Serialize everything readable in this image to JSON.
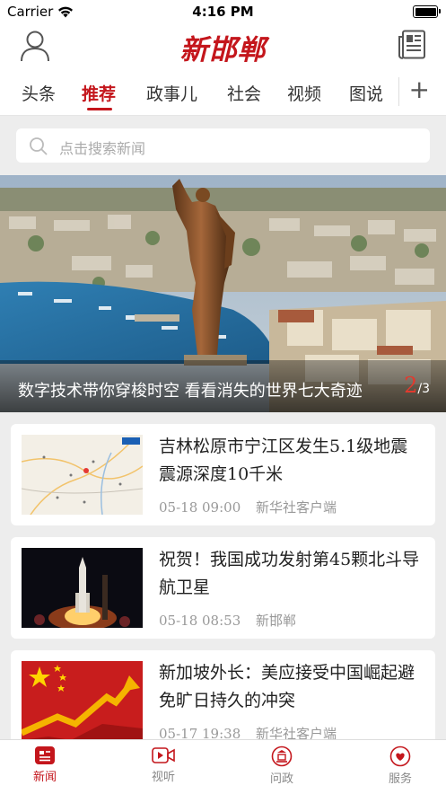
{
  "status": {
    "carrier": "Carrier",
    "time": "4:16 PM"
  },
  "header": {
    "logo": "新邯郸",
    "left_icon": "user-icon",
    "right_icon": "newspaper-icon"
  },
  "tabs": [
    {
      "label": "头条"
    },
    {
      "label": "推荐",
      "active": true
    },
    {
      "label": "政事儿"
    },
    {
      "label": "社会"
    },
    {
      "label": "视频"
    },
    {
      "label": "图说"
    }
  ],
  "search": {
    "placeholder": "点击搜索新闻"
  },
  "hero": {
    "caption": "数字技术带你穿梭时空 看看消失的世界七大奇迹",
    "page_current": "2",
    "page_total": "/3"
  },
  "news": [
    {
      "title": "吉林松原市宁江区发生5.1级地震震源深度10千米",
      "time": "05-18 09:00",
      "source": "新华社客户端"
    },
    {
      "title": "祝贺！我国成功发射第45颗北斗导航卫星",
      "time": "05-18 08:53",
      "source": "新邯郸"
    },
    {
      "title": "新加坡外长：美应接受中国崛起避免旷日持久的冲突",
      "time": "05-17 19:38",
      "source": "新华社客户端"
    }
  ],
  "bottom_nav": [
    {
      "label": "新闻",
      "active": true
    },
    {
      "label": "视听"
    },
    {
      "label": "问政"
    },
    {
      "label": "服务"
    }
  ],
  "colors": {
    "accent": "#c4161c",
    "background": "#ededed"
  }
}
